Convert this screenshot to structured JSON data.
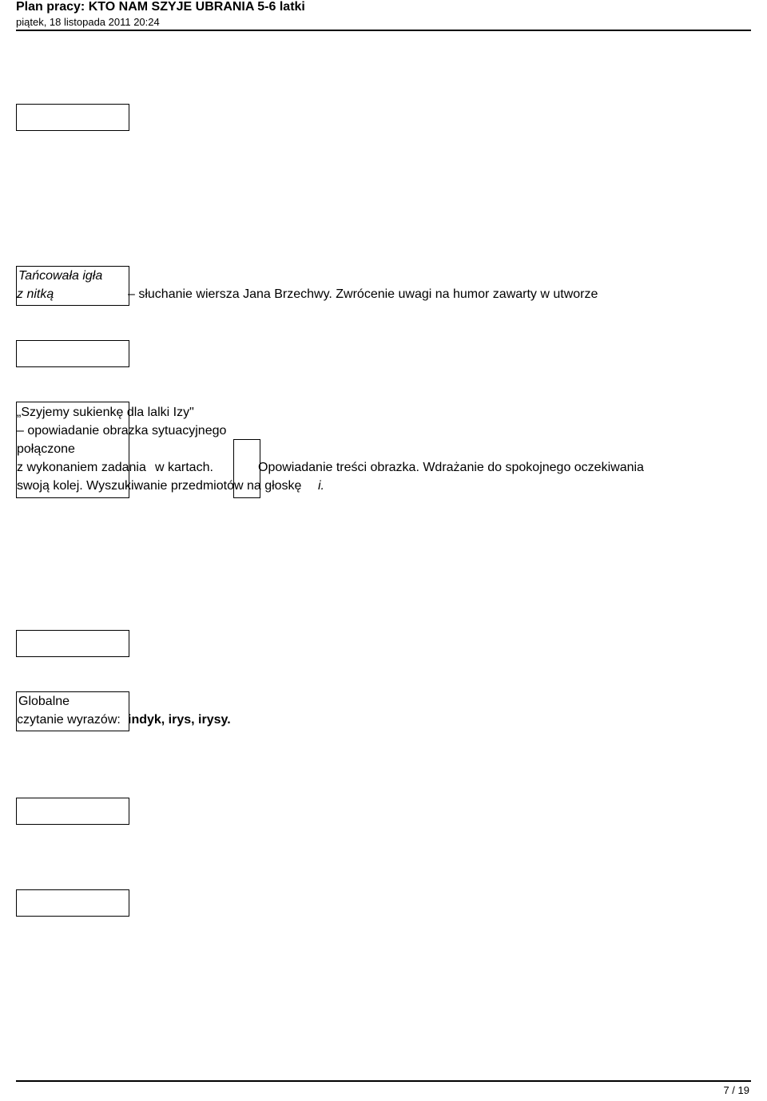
{
  "header": {
    "title": "Plan pracy: KTO NAM SZYJE UBRANIA 5-6 latki",
    "date": "piątek, 18 listopada 2011 20:24"
  },
  "blocks": {
    "tancowala_line1": "Tańcowała igła",
    "tancowala_line2": " z nitką",
    "sluchanie": " – słuchanie wiersza Jana Brzechwy. Zwrócenie uwagi na humor zawarty w utworze",
    "szyjemy_line1": " „Szyjemy sukienkę dla lalki Izy\"",
    "szyjemy_line2": " – opowiadanie obrazka sytuacyjnego",
    "szyjemy_line3": " połączone",
    "szyjemy_line4_a": " z wykonaniem zadania",
    "szyjemy_line4_b": " w kartach.",
    "opowiadanie": "Opowiadanie treści obrazka. Wdrażanie do spokojnego oczekiwania",
    "swoja_kolej": " swoją kolej. Wyszukiwanie przedmiotów na głoskę",
    "letter_i": "i.",
    "globalne_line1": "Globalne",
    "globalne_line2_a": " czytanie wyrazów:",
    "globalne_line2_b": " indyk, irys, irysy."
  },
  "footer": {
    "page": "7 / 19"
  }
}
